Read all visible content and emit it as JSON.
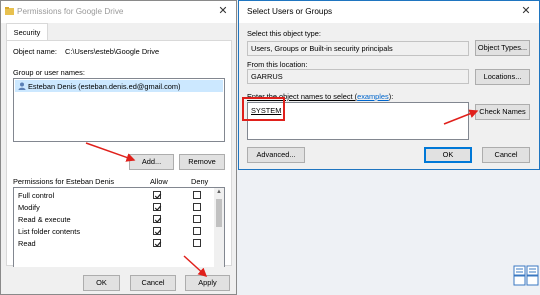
{
  "perm_dialog": {
    "title": "Permissions for Google Drive",
    "tab": "Security",
    "object_label": "Object name:",
    "object_value": "C:\\Users\\esteb\\Google Drive",
    "group_label": "Group or user names:",
    "user": "Esteban Denis (esteban.denis.ed@gmail.com)",
    "add": "Add...",
    "remove": "Remove",
    "perm_header": "Permissions for Esteban Denis",
    "allow": "Allow",
    "deny": "Deny",
    "permissions": [
      {
        "name": "Full control",
        "allow": true
      },
      {
        "name": "Modify",
        "allow": true
      },
      {
        "name": "Read & execute",
        "allow": true
      },
      {
        "name": "List folder contents",
        "allow": true
      },
      {
        "name": "Read",
        "allow": true
      }
    ],
    "ok": "OK",
    "cancel": "Cancel",
    "apply": "Apply"
  },
  "select_dialog": {
    "title": "Select Users or Groups",
    "object_type_label": "Select this object type:",
    "object_type_value": "Users, Groups or Built-in security principals",
    "object_types_btn": "Object Types...",
    "location_label": "From this location:",
    "location_value": "GARRUS",
    "locations_btn": "Locations...",
    "enter_label_pre": "Enter the object names to select (",
    "enter_label_link": "examples",
    "enter_label_post": "):",
    "names_value": "SYSTEM",
    "check_names": "Check Names",
    "advanced": "Advanced...",
    "ok": "OK",
    "cancel": "Cancel"
  },
  "colors": {
    "annotation": "#e0201b",
    "accent": "#0078d7",
    "highlight": "#cce8ff"
  },
  "icons": [
    "user-icon",
    "close-icon",
    "checkmark-icon",
    "scroll-up-icon",
    "scroll-down-icon",
    "taskbar-icon"
  ]
}
